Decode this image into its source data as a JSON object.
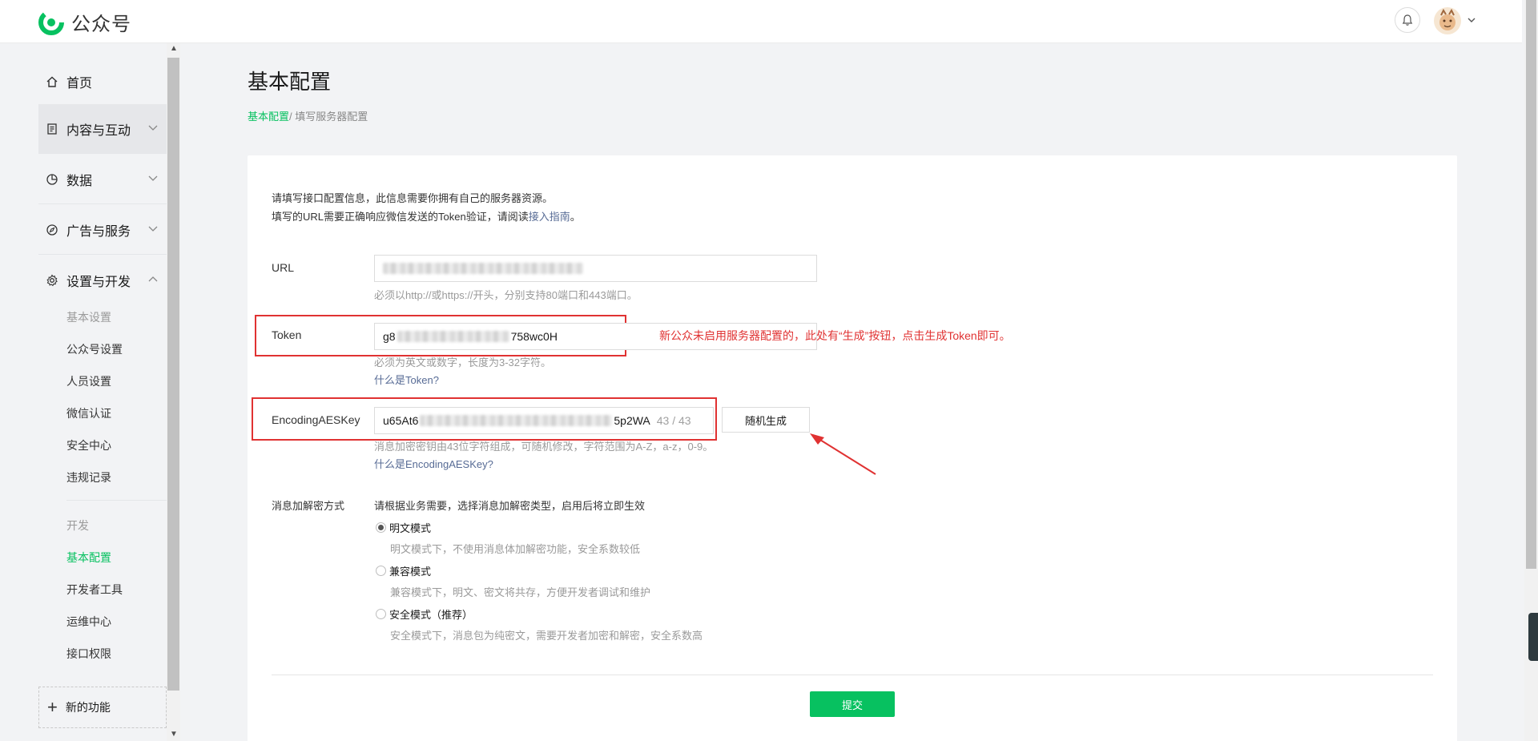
{
  "header": {
    "logo_text": "公众号",
    "brand_color": "#07c160",
    "bell_icon": "bell-icon",
    "avatar_icon": "avatar-image"
  },
  "sidebar": {
    "home": "首页",
    "groups": [
      {
        "label": "内容与互动",
        "icon": "document-icon",
        "expanded": false
      },
      {
        "label": "数据",
        "icon": "pie-chart-icon",
        "expanded": false
      },
      {
        "label": "广告与服务",
        "icon": "compass-icon",
        "expanded": false
      },
      {
        "label": "设置与开发",
        "icon": "gear-icon",
        "expanded": true
      }
    ],
    "settings_items": [
      "基本设置",
      "公众号设置",
      "人员设置",
      "微信认证",
      "安全中心",
      "违规记录"
    ],
    "dev_heading": "开发",
    "dev_items": [
      "基本配置",
      "开发者工具",
      "运维中心",
      "接口权限"
    ],
    "active_item": "基本配置",
    "new_feature": "新的功能"
  },
  "main": {
    "title": "基本配置",
    "breadcrumb": {
      "link": "基本配置",
      "separator": "/",
      "current": " 填写服务器配置"
    },
    "intro_line1": "请填写接口配置信息，此信息需要你拥有自己的服务器资源。",
    "intro_line2_prefix": "填写的URL需要正确响应微信发送的Token验证，请阅读",
    "intro_link": "接入指南",
    "intro_line2_suffix": "。",
    "url": {
      "label": "URL",
      "hint": "必须以http://或https://开头，分别支持80端口和443端口。"
    },
    "token": {
      "label": "Token",
      "value_start": "g8",
      "value_end": "758wc0H",
      "hint": "必须为英文或数字，长度为3-32字符。",
      "help": "什么是Token?"
    },
    "aes": {
      "label": "EncodingAESKey",
      "value_start": "u65At6",
      "value_end": "5p2WA",
      "counter": "43 / 43",
      "generate_button": "随机生成",
      "hint": "消息加密密钥由43位字符组成，可随机修改，字符范围为A-Z，a-z，0-9。",
      "help": "什么是EncodingAESKey?"
    },
    "annotation": "新公众未启用服务器配置的，此处有“生成”按钮，点击生成Token即可。",
    "encryption": {
      "label": "消息加解密方式",
      "intro": "请根据业务需要，选择消息加解密类型，启用后将立即生效",
      "options": [
        {
          "label": "明文模式",
          "desc": "明文模式下，不使用消息体加解密功能，安全系数较低",
          "checked": true
        },
        {
          "label": "兼容模式",
          "desc": "兼容模式下，明文、密文将共存，方便开发者调试和维护",
          "checked": false
        },
        {
          "label": "安全模式（推荐）",
          "desc": "安全模式下，消息包为纯密文，需要开发者加密和解密，安全系数高",
          "checked": false
        }
      ]
    },
    "submit": "提交"
  }
}
